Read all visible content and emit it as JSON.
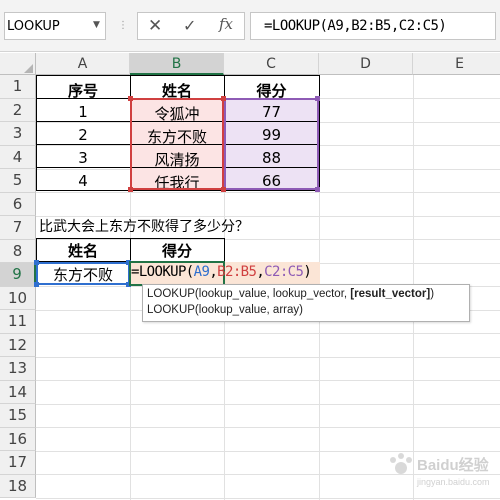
{
  "name_box": "LOOKUP",
  "formula_bar": {
    "cancel": "✕",
    "enter": "✓",
    "fx": "fx",
    "formula": "=LOOKUP(A9,B2:B5,C2:C5)"
  },
  "columns": [
    "A",
    "B",
    "C",
    "D",
    "E"
  ],
  "rows": [
    "1",
    "2",
    "3",
    "4",
    "5",
    "6",
    "7",
    "8",
    "9",
    "10",
    "11",
    "12",
    "13",
    "14",
    "15",
    "16",
    "17",
    "18"
  ],
  "table": {
    "headers": [
      "序号",
      "姓名",
      "得分"
    ],
    "rows": [
      [
        "1",
        "令狐冲",
        "77"
      ],
      [
        "2",
        "东方不败",
        "99"
      ],
      [
        "3",
        "风清扬",
        "88"
      ],
      [
        "4",
        "任我行",
        "66"
      ]
    ]
  },
  "question": "比武大会上东方不败得了多少分？",
  "lookup": {
    "headers": [
      "姓名",
      "得分"
    ],
    "name_value": "东方不败",
    "formula_parts": [
      "=LOOKUP(",
      "A9",
      ",",
      "B2:B5",
      ",",
      "C2:C5",
      ")"
    ]
  },
  "tooltip": {
    "line1_pre": "LOOKUP(lookup_value, lookup_vector, ",
    "line1_bold": "[result_vector]",
    "line1_post": ")",
    "line2": "LOOKUP(lookup_value, array)"
  },
  "watermark": {
    "text": "Baidu经验",
    "sub": "jingyan.baidu.com"
  },
  "colors": {
    "b_range": "#d04040",
    "c_range": "#8e5bb5",
    "a9_ref": "#2f6fcf",
    "accent": "#217346"
  }
}
